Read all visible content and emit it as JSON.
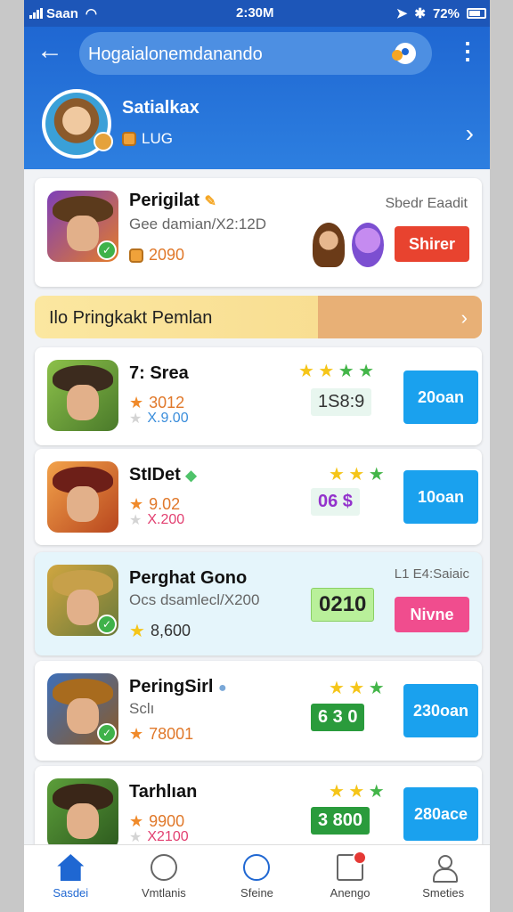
{
  "status_bar": {
    "carrier": "Saan",
    "time": "2:30M",
    "battery": "72%"
  },
  "header": {
    "search_text": "Hogaialonemdanando",
    "profile": {
      "name": "Satialkax",
      "level": "LUG"
    }
  },
  "featured": {
    "title": "Perigilat",
    "subtitle": "Gee damian/X2:12D",
    "score": "2090",
    "right_label": "Sbedr Eaadit",
    "button": "Shirer"
  },
  "promo": {
    "text": "Ilo Pringkakt Pemlan"
  },
  "games": [
    {
      "title": "7: Srea",
      "rating": "3012",
      "sub": "X.9.00",
      "stars": [
        "★",
        "★",
        "★",
        "★"
      ],
      "value": "1S8:9",
      "button": "20oan"
    },
    {
      "title": "StIDet",
      "rating": "9.02",
      "sub": "X.200",
      "stars": [
        "★",
        "★",
        "★"
      ],
      "value": "06 $",
      "button": "10oan"
    },
    {
      "title": "Perghat Gono",
      "rating": "8,600",
      "sub": "Ocs dsamlecl/X200",
      "right_label": "L1 E4:Saiaic",
      "value": "0210",
      "button": "Nivne"
    },
    {
      "title": "PeringSirl",
      "rating": "78001",
      "sub": "Sclı",
      "stars": [
        "★",
        "★",
        "★"
      ],
      "value": "6 3 0",
      "button": "230oan"
    },
    {
      "title": "Tarhlıan",
      "rating": "9900",
      "sub": "X2100",
      "stars": [
        "★",
        "★",
        "★"
      ],
      "value": "3 800",
      "button": "280ace"
    }
  ],
  "bottom_nav": [
    {
      "label": "Sasdei",
      "icon": "home-icon"
    },
    {
      "label": "Vmtlanis",
      "icon": "tools-icon"
    },
    {
      "label": "Sfeine",
      "icon": "store-icon"
    },
    {
      "label": "Anengo",
      "icon": "message-icon"
    },
    {
      "label": "Smeties",
      "icon": "profile-icon"
    }
  ],
  "colors": {
    "primary": "#1f67d2",
    "cta_blue": "#1aa1ee",
    "cta_red": "#e8432f",
    "cta_pink": "#f04d8e"
  }
}
